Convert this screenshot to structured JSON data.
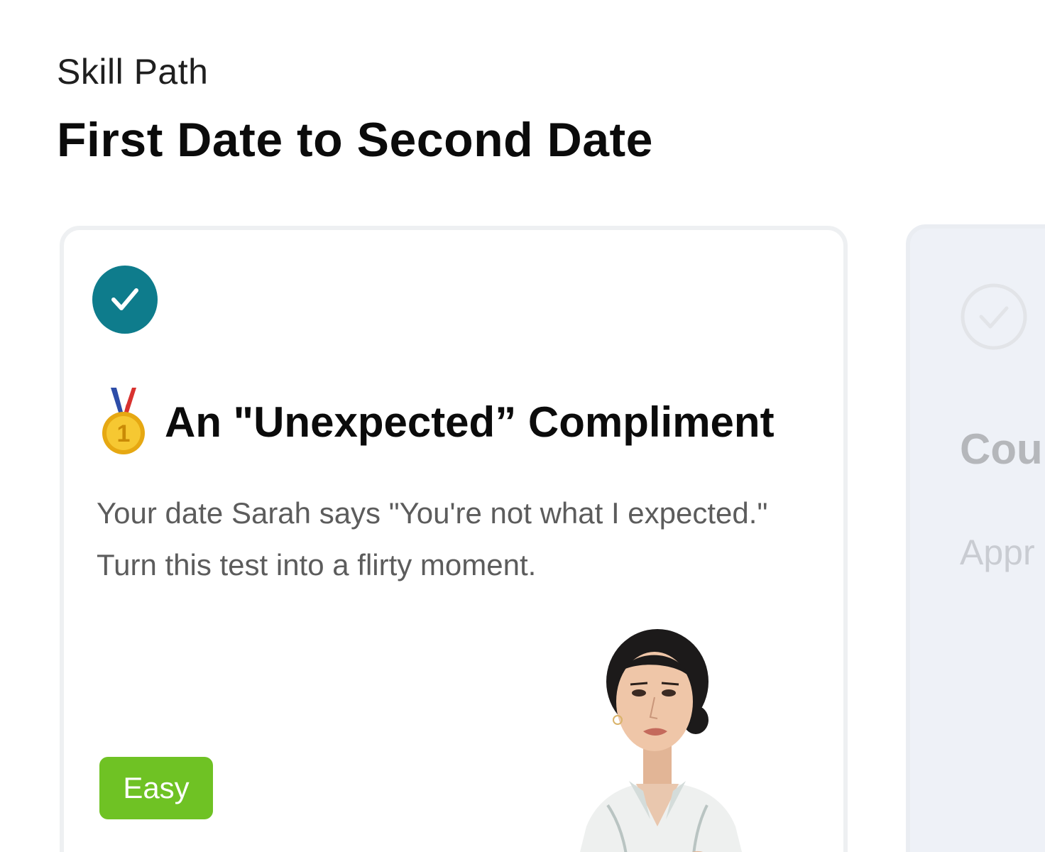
{
  "header": {
    "eyebrow": "Skill Path",
    "title": "First Date to Second Date"
  },
  "cards": [
    {
      "status": "completed",
      "status_icon": "check-icon",
      "title_icon": "first-place-medal-icon",
      "title": "An \"Unexpected” Compliment",
      "description": "Your date Sarah says \"You're not what I expected.\" Turn this test into a flirty moment.",
      "difficulty": "Easy",
      "character_image": "woman-illustration"
    },
    {
      "status": "pending",
      "status_icon": "check-icon",
      "title": "Cou",
      "description": "Appr benc"
    }
  ],
  "colors": {
    "completed_badge": "#0e7c8c",
    "difficulty_easy": "#6fc224",
    "next_card_bg": "#eef1f7"
  }
}
